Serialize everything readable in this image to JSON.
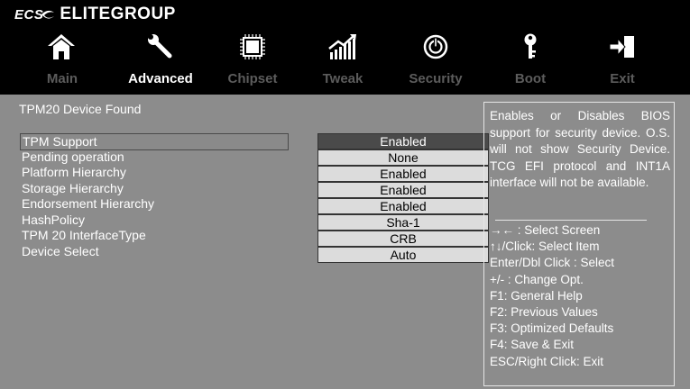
{
  "brand": {
    "mark": "ECS",
    "name": "ELITEGROUP"
  },
  "nav": {
    "icons": [
      "home-icon",
      "wrench-icon",
      "chip-icon",
      "performance-chart-icon",
      "power-icon",
      "key-icon",
      "exit-icon"
    ],
    "tabs": [
      "Main",
      "Advanced",
      "Chipset",
      "Tweak",
      "Security",
      "Boot",
      "Exit"
    ],
    "active_tab": "Advanced"
  },
  "main": {
    "status": "TPM20 Device Found",
    "settings": [
      {
        "label": "TPM Support",
        "value": "Enabled"
      },
      {
        "label": "Pending operation",
        "value": "None"
      },
      {
        "label": "Platform Hierarchy",
        "value": "Enabled"
      },
      {
        "label": "Storage Hierarchy",
        "value": "Enabled"
      },
      {
        "label": "Endorsement Hierarchy",
        "value": "Enabled"
      },
      {
        "label": "HashPolicy",
        "value": "Sha-1"
      },
      {
        "label": "TPM 20 InterfaceType",
        "value": "CRB"
      },
      {
        "label": "Device Select",
        "value": "Auto"
      }
    ]
  },
  "help": {
    "description": "Enables or Disables BIOS support for security device. O.S. will not show Security Device. TCG EFI protocol and INT1A interface will not be available.",
    "keys": [
      "→← : Select Screen",
      "↑↓/Click: Select Item",
      "Enter/Dbl Click : Select",
      "+/- : Change Opt.",
      "F1: General Help",
      "F2: Previous Values",
      "F3: Optimized Defaults",
      "F4: Save & Exit",
      "ESC/Right Click: Exit"
    ]
  },
  "colors": {
    "background": "#8c8c8c",
    "topbar": "#000000",
    "selected_value": "#4a4a4a",
    "value_box": "#dcdcdc",
    "inactive_tab": "#5c5c5c"
  }
}
